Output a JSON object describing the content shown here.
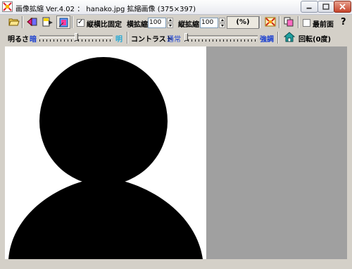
{
  "window": {
    "title": "画像拡縮 Ver.4.02 ： hanako.jpg  拡縮画像 (375×397)"
  },
  "toolbar": {
    "keep_ratio_label": "縦横比固定",
    "keep_ratio_checked": true,
    "width_label": "横拡縮",
    "width_value": "100",
    "height_label": "縦拡縮",
    "height_value": "100",
    "percent_label": "(%)",
    "topmost_label": "最前面",
    "topmost_checked": false,
    "help_label": "?"
  },
  "adjust": {
    "brightness_label": "明るさ",
    "brightness_dark": "暗",
    "brightness_bright": "明",
    "contrast_label": "コントラスト",
    "contrast_normal": "通常",
    "contrast_strong": "強調",
    "rotate_label": "回転(0度)"
  },
  "image": {
    "filename": "hanako.jpg",
    "subject": "black silhouette of a person"
  },
  "colors": {
    "canvas_bg": "#a0a0a0",
    "window_bg": "#d4d0c8",
    "accent_blue": "#1a3fcf",
    "accent_cyan": "#25a8d4"
  }
}
